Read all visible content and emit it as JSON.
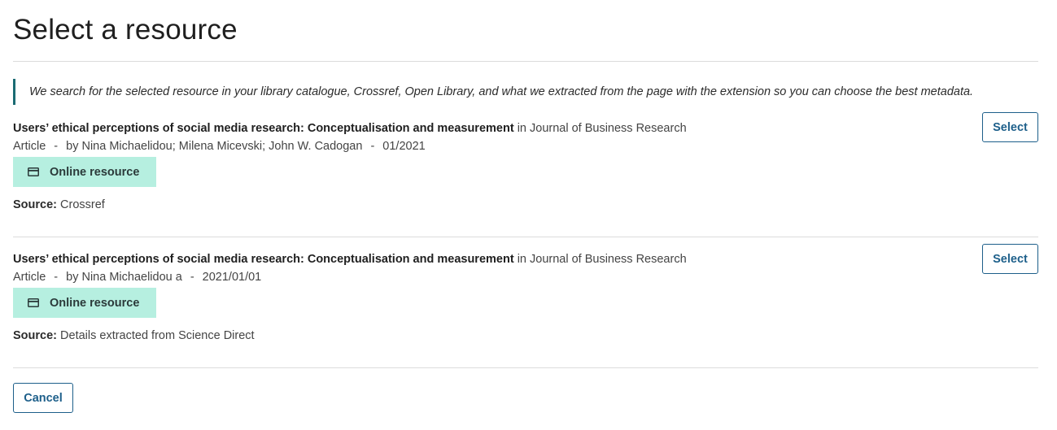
{
  "page": {
    "title": "Select a resource",
    "info_note": "We search for the selected resource in your library catalogue, Crossref, Open Library, and what we extracted from the page with the extension so you can choose the best metadata."
  },
  "results": [
    {
      "title": "Users’ ethical perceptions of social media research: Conceptualisation and measurement",
      "journal": "in Journal of Business Research",
      "type": "Article",
      "separator": "-",
      "authors": "by Nina Michaelidou; Milena Micevski; John W. Cadogan",
      "date": "01/2021",
      "badge_label": "Online resource",
      "badge_icon": "credit-card-icon",
      "source_label": "Source:",
      "source_value": "Crossref",
      "select_label": "Select"
    },
    {
      "title": "Users’ ethical perceptions of social media research: Conceptualisation and measurement",
      "journal": "in Journal of Business Research",
      "type": "Article",
      "separator": "-",
      "authors": "by Nina Michaelidou a",
      "date": "2021/01/01",
      "badge_label": "Online resource",
      "badge_icon": "credit-card-icon",
      "source_label": "Source:",
      "source_value": "Details extracted from Science Direct",
      "select_label": "Select"
    }
  ],
  "footer": {
    "cancel_label": "Cancel"
  },
  "colors": {
    "accent": "#1d5f8a",
    "badge_bg": "#b6efe0",
    "note_border": "#1b6b73",
    "rule": "#dcdcdc"
  }
}
